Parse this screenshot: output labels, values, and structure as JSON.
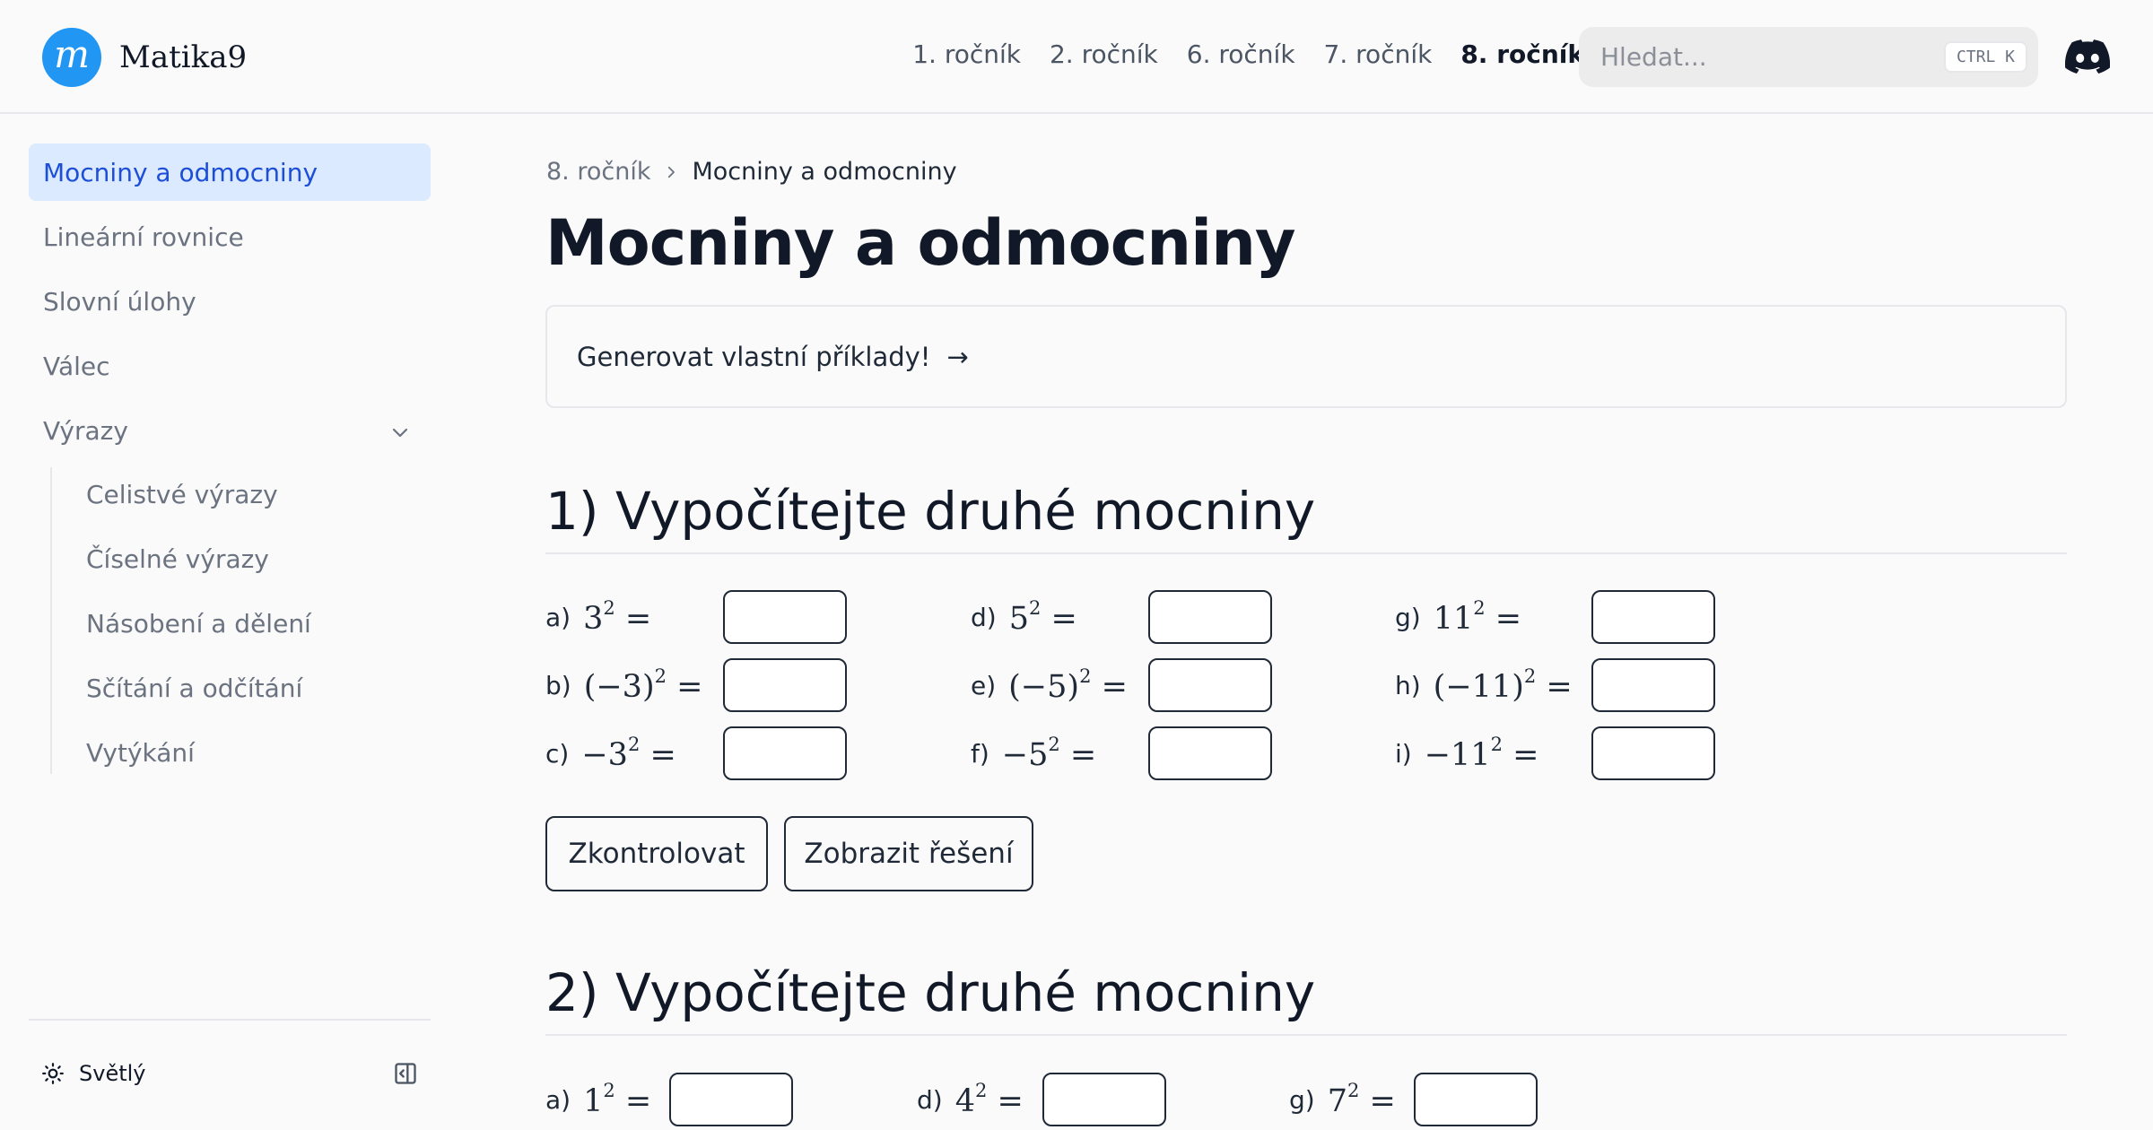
{
  "header": {
    "logo_letter": "m",
    "brand": "Matika9",
    "nav": [
      {
        "label": "1. ročník"
      },
      {
        "label": "2. ročník"
      },
      {
        "label": "6. ročník"
      },
      {
        "label": "7. ročník"
      },
      {
        "label": "8. ročník",
        "active": true
      }
    ],
    "search": {
      "placeholder": "Hledat...",
      "shortcut": "CTRL K"
    },
    "discord_icon": "discord-icon"
  },
  "sidebar": {
    "items": [
      {
        "label": "Mocniny a odmocniny",
        "active": true
      },
      {
        "label": "Lineární rovnice"
      },
      {
        "label": "Slovní úlohy"
      },
      {
        "label": "Válec"
      },
      {
        "label": "Výrazy",
        "expanded": true
      }
    ],
    "subitems": [
      {
        "label": "Celistvé výrazy"
      },
      {
        "label": "Číselné výrazy"
      },
      {
        "label": "Násobení a dělení"
      },
      {
        "label": "Sčítání a odčítání"
      },
      {
        "label": "Vytýkání"
      }
    ],
    "theme_label": "Světlý"
  },
  "breadcrumb": {
    "parent": "8. ročník",
    "current": "Mocniny a odmocniny"
  },
  "page_title": "Mocniny a odmocniny",
  "generate_card": {
    "label": "Generovat vlastní příklady!",
    "arrow": "→"
  },
  "sections": [
    {
      "title": "1) Vypočítejte druhé mocniny",
      "exercises": [
        {
          "label": "a)",
          "expr": "3",
          "exp": "2",
          "suffix": " ="
        },
        {
          "label": "b)",
          "expr": "(−3)",
          "exp": "2",
          "suffix": " ="
        },
        {
          "label": "c)",
          "expr": "−3",
          "exp": "2",
          "suffix": " ="
        },
        {
          "label": "d)",
          "expr": "5",
          "exp": "2",
          "suffix": " ="
        },
        {
          "label": "e)",
          "expr": "(−5)",
          "exp": "2",
          "suffix": " ="
        },
        {
          "label": "f)",
          "expr": "−5",
          "exp": "2",
          "suffix": " ="
        },
        {
          "label": "g)",
          "expr": "11",
          "exp": "2",
          "suffix": " ="
        },
        {
          "label": "h)",
          "expr": "(−11)",
          "exp": "2",
          "suffix": " ="
        },
        {
          "label": "i)",
          "expr": "−11",
          "exp": "2",
          "suffix": " ="
        }
      ],
      "check_button": "Zkontrolovat",
      "solution_button": "Zobrazit řešení"
    },
    {
      "title": "2) Vypočítejte druhé mocniny",
      "exercises": [
        {
          "label": "a)",
          "expr": "1",
          "exp": "2",
          "suffix": " ="
        },
        {
          "label": "d)",
          "expr": "4",
          "exp": "2",
          "suffix": " ="
        },
        {
          "label": "g)",
          "expr": "7",
          "exp": "2",
          "suffix": " ="
        }
      ]
    }
  ]
}
